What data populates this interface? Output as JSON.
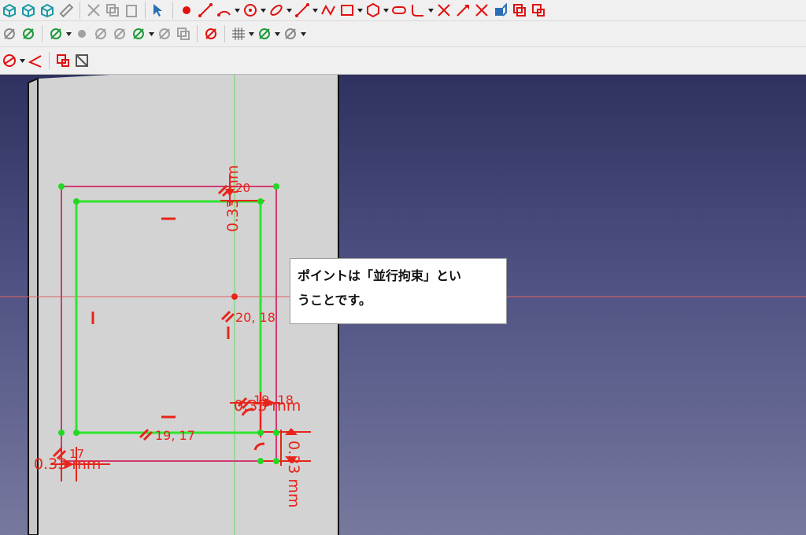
{
  "toolbars": {
    "row1": [
      {
        "name": "view-iso-icon",
        "color": "#1a9aa8",
        "dropdown": false
      },
      {
        "name": "view-box-icon",
        "color": "#1a9aa8",
        "dropdown": false
      },
      {
        "name": "view-front-icon",
        "color": "#1a9aa8",
        "dropdown": false
      },
      {
        "name": "measure-icon",
        "color": "#8a8a8a",
        "dropdown": false
      },
      {
        "sep": true
      },
      {
        "name": "cut-icon",
        "color": "#a0a0a0",
        "dropdown": false
      },
      {
        "name": "copy-icon",
        "color": "#a0a0a0",
        "dropdown": false
      },
      {
        "name": "paste-icon",
        "color": "#a0a0a0",
        "dropdown": false
      },
      {
        "sep": true
      },
      {
        "name": "whats-this-icon",
        "color": "#2a6fb5",
        "dropdown": false
      },
      {
        "sep": true
      },
      {
        "name": "sketch-point-icon",
        "color": "#e01010",
        "dropdown": false
      },
      {
        "name": "sketch-line-icon",
        "color": "#e01010",
        "dropdown": false
      },
      {
        "name": "sketch-arc-icon",
        "color": "#e01010",
        "dropdown": true
      },
      {
        "name": "sketch-circle-icon",
        "color": "#e01010",
        "dropdown": true
      },
      {
        "name": "sketch-conic-icon",
        "color": "#e01010",
        "dropdown": true
      },
      {
        "name": "sketch-bspline-icon",
        "color": "#e01010",
        "dropdown": true
      },
      {
        "name": "sketch-polyline-icon",
        "color": "#e01010",
        "dropdown": false
      },
      {
        "name": "sketch-rectangle-icon",
        "color": "#e01010",
        "dropdown": true
      },
      {
        "name": "sketch-polygon-icon",
        "color": "#e01010",
        "dropdown": true
      },
      {
        "name": "sketch-slot-icon",
        "color": "#e01010",
        "dropdown": false
      },
      {
        "name": "sketch-fillet-icon",
        "color": "#e01010",
        "dropdown": true
      },
      {
        "name": "sketch-trim-icon",
        "color": "#e01010",
        "dropdown": false
      },
      {
        "name": "sketch-extend-icon",
        "color": "#e01010",
        "dropdown": false
      },
      {
        "name": "sketch-split-icon",
        "color": "#e01010",
        "dropdown": false
      },
      {
        "name": "external-geometry-icon",
        "color": "#2a6fb5",
        "dropdown": false
      },
      {
        "name": "carbon-copy-icon",
        "color": "#e01010",
        "dropdown": false
      },
      {
        "name": "construction-mode-icon",
        "color": "#e01010",
        "dropdown": false
      }
    ],
    "row2": [
      {
        "name": "select-constraints-icon",
        "color": "#8a8a8a",
        "dropdown": false
      },
      {
        "name": "delete-constraints-icon",
        "color": "#1e9a3a",
        "dropdown": false
      },
      {
        "sep": true
      },
      {
        "name": "validate-sketch-icon",
        "color": "#1e9a3a",
        "dropdown": true
      },
      {
        "name": "select-points-icon",
        "color": "#a0a0a0",
        "dropdown": false
      },
      {
        "name": "associated-constraints-icon",
        "color": "#a0a0a0",
        "dropdown": false
      },
      {
        "name": "associated-geometry-icon",
        "color": "#a0a0a0",
        "dropdown": false
      },
      {
        "name": "restore-constraints-icon",
        "color": "#1e9a3a",
        "dropdown": true
      },
      {
        "name": "symmetry-tool-icon",
        "color": "#a0a0a0",
        "dropdown": false
      },
      {
        "name": "clone-tool-icon",
        "color": "#a0a0a0",
        "dropdown": false
      },
      {
        "sep": true
      },
      {
        "name": "remove-axes-icon",
        "color": "#e01010",
        "dropdown": false
      },
      {
        "sep": true
      },
      {
        "name": "grid-icon",
        "color": "#555555",
        "dropdown": true
      },
      {
        "name": "snap-icon",
        "color": "#1e9a3a",
        "dropdown": true
      },
      {
        "name": "rendering-order-icon",
        "color": "#8a8a8a",
        "dropdown": true
      }
    ],
    "row3": [
      {
        "name": "constrain-block-icon",
        "color": "#e01010",
        "dropdown": true
      },
      {
        "name": "constrain-angle-icon",
        "color": "#e01010",
        "dropdown": false
      },
      {
        "sep": true
      },
      {
        "name": "toggle-construction-icon",
        "color": "#e01010",
        "dropdown": false
      },
      {
        "name": "toggle-driving-icon",
        "color": "#555555",
        "dropdown": false
      }
    ]
  },
  "tooltip": {
    "line1": "ポイントは「並行拘束」とい",
    "line2": "うことです。"
  },
  "sketch": {
    "labels": {
      "dim_top": "0.33 mm",
      "dim_right": "0.33 mm",
      "dim_right2": "0.33 mm",
      "dim_bottom_left": "0.33 mm",
      "parallel_20_top": "20",
      "parallel_20_18": "20, 18",
      "parallel_19_18": "19, 18",
      "parallel_19_17": "19, 17",
      "parallel_17": "17"
    },
    "colors": {
      "outer": "#d03a72",
      "inner": "#2ee62e",
      "constraint": "#e8241a",
      "axis_v": "#5fd85f",
      "axis_h": "#e06060",
      "point": "#22d822"
    }
  }
}
